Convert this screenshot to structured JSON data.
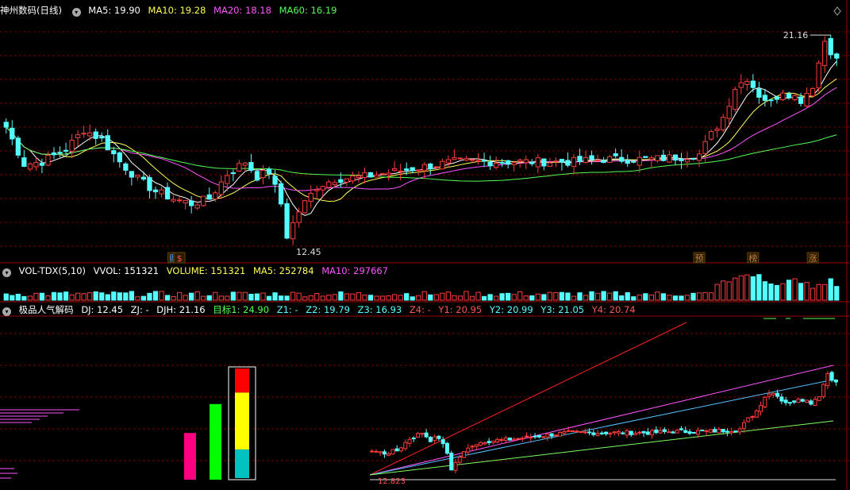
{
  "main": {
    "title": "神州数码(日线)",
    "ma": [
      {
        "label": "MA5: 19.90",
        "color": "#ffffff"
      },
      {
        "label": "MA10: 19.28",
        "color": "#ffff54"
      },
      {
        "label": "MA20: 18.18",
        "color": "#ff54ff"
      },
      {
        "label": "MA60: 16.19",
        "color": "#54ff54"
      }
    ],
    "high_label": "21.16",
    "low_label": "12.45",
    "markers": [
      {
        "text": "财",
        "index": 28,
        "color": "#54a0ff"
      },
      {
        "text": "$",
        "index": 29,
        "color": "#ff5454"
      },
      {
        "text": "预",
        "index": 116,
        "color": "#c08040"
      },
      {
        "text": "榜",
        "index": 125,
        "color": "#c08040"
      },
      {
        "text": "涨",
        "index": 135,
        "color": "#c08040"
      }
    ]
  },
  "volume": {
    "title": "VOL-TDX(5,10)",
    "items": [
      {
        "label": "VVOL: 151321",
        "color": "#ffffff"
      },
      {
        "label": "VOLUME: 151321",
        "color": "#ffff54"
      },
      {
        "label": "MA5: 252784",
        "color": "#ffff54"
      },
      {
        "label": "MA10: 297667",
        "color": "#ff54ff"
      }
    ]
  },
  "indicator": {
    "title": "极品人气解码",
    "items": [
      {
        "label": "DJ: 12.45",
        "color": "#ffffff"
      },
      {
        "label": "ZJ: -",
        "color": "#ffffff"
      },
      {
        "label": "DJH: 21.16",
        "color": "#ffffff"
      },
      {
        "label": "目标1: 24.90",
        "color": "#54ff54"
      },
      {
        "label": "Z1: -",
        "color": "#54ffff"
      },
      {
        "label": "Z2: 19.79",
        "color": "#54ffff"
      },
      {
        "label": "Z3: 16.93",
        "color": "#54ffff"
      },
      {
        "label": "Z4: -",
        "color": "#ff5454"
      },
      {
        "label": "Y1: 20.95",
        "color": "#ff5454"
      },
      {
        "label": "Y2: 20.99",
        "color": "#54ffff"
      },
      {
        "label": "Y3: 21.05",
        "color": "#54ffff"
      },
      {
        "label": "Y4: 20.74",
        "color": "#ff5454"
      }
    ],
    "low_label": "12.823",
    "bars": [
      {
        "name": "magenta-bar",
        "value": 0.42,
        "color": "#ff0080"
      },
      {
        "name": "green-bar",
        "value": 0.68,
        "color": "#00ff00"
      },
      {
        "name": "stack-bar",
        "segments": [
          {
            "value": 0.22,
            "color": "#ff0000"
          },
          {
            "value": 0.52,
            "color": "#ffff00"
          },
          {
            "value": 0.26,
            "color": "#00c0c0"
          }
        ]
      }
    ]
  },
  "colors": {
    "up": "#ff3b3b",
    "down": "#54ffff",
    "grid": "#7a0000",
    "bg": "#000000"
  },
  "chart_data": {
    "type": "candlestick",
    "count": 140,
    "price_range": [
      12.0,
      21.8
    ],
    "anchors": [
      [
        0,
        17.3
      ],
      [
        3,
        15.8
      ],
      [
        6,
        15.9
      ],
      [
        10,
        16.4
      ],
      [
        13,
        17.2
      ],
      [
        16,
        16.8
      ],
      [
        19,
        15.9
      ],
      [
        22,
        15.2
      ],
      [
        25,
        14.7
      ],
      [
        28,
        14.4
      ],
      [
        31,
        14.2
      ],
      [
        34,
        14.4
      ],
      [
        37,
        15.4
      ],
      [
        40,
        15.9
      ],
      [
        42,
        15.3
      ],
      [
        44,
        15.5
      ],
      [
        46,
        14.2
      ],
      [
        47,
        12.9
      ],
      [
        49,
        13.9
      ],
      [
        52,
        14.9
      ],
      [
        55,
        15.2
      ],
      [
        60,
        15.3
      ],
      [
        65,
        15.5
      ],
      [
        70,
        15.7
      ],
      [
        75,
        15.9
      ],
      [
        80,
        15.9
      ],
      [
        85,
        15.9
      ],
      [
        90,
        15.9
      ],
      [
        95,
        15.9
      ],
      [
        100,
        16.0
      ],
      [
        108,
        16.0
      ],
      [
        113,
        16.1
      ],
      [
        116,
        16.2
      ],
      [
        118,
        17.0
      ],
      [
        120,
        17.7
      ],
      [
        122,
        18.9
      ],
      [
        124,
        19.3
      ],
      [
        126,
        18.6
      ],
      [
        128,
        18.3
      ],
      [
        130,
        18.8
      ],
      [
        133,
        18.4
      ],
      [
        135,
        19.0
      ],
      [
        137,
        20.8
      ],
      [
        139,
        20.0
      ]
    ]
  }
}
